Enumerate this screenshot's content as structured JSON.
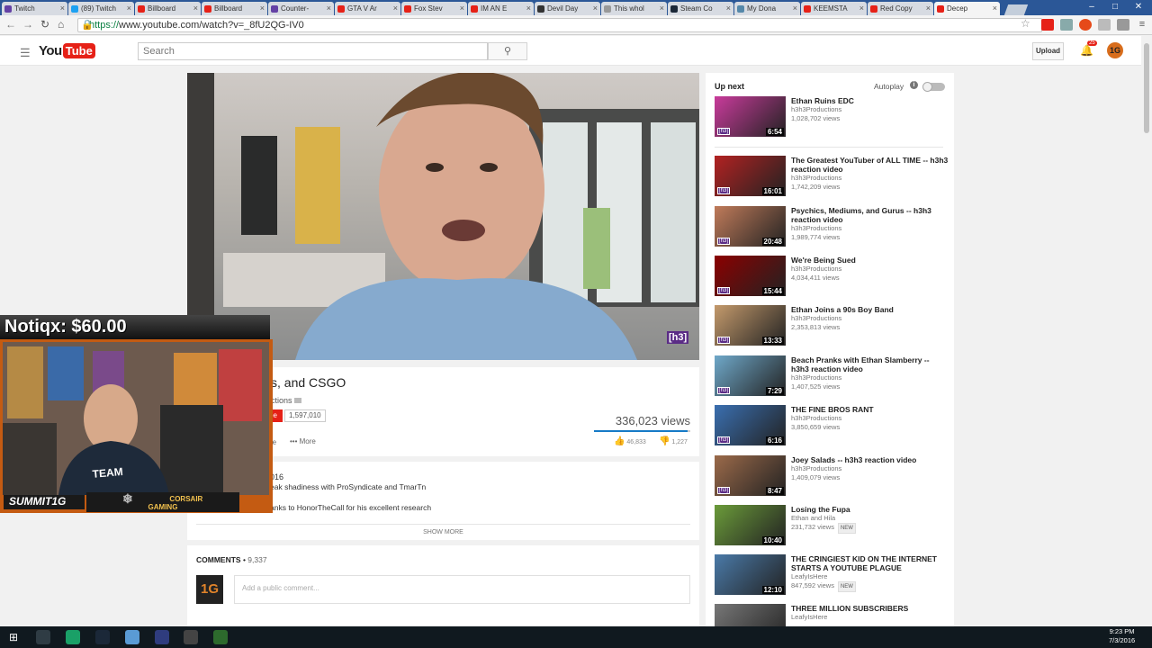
{
  "browser": {
    "tabs": [
      {
        "title": "Twitch",
        "color": "#6441a5",
        "active": false
      },
      {
        "title": "(89) Twitch",
        "color": "#1da1f2",
        "active": false
      },
      {
        "title": "Billboard",
        "color": "#e62117",
        "active": false
      },
      {
        "title": "Billboard",
        "color": "#e62117",
        "active": false
      },
      {
        "title": "Counter-",
        "color": "#6441a5",
        "active": false
      },
      {
        "title": "GTA V Ar",
        "color": "#e62117",
        "active": false
      },
      {
        "title": "Fox Stev",
        "color": "#e62117",
        "active": false
      },
      {
        "title": "IM AN E",
        "color": "#e62117",
        "active": false
      },
      {
        "title": "Devil Day",
        "color": "#333333",
        "active": false
      },
      {
        "title": "This whol",
        "color": "#999999",
        "active": false
      },
      {
        "title": "Steam Co",
        "color": "#1b2838",
        "active": false
      },
      {
        "title": "My Dona",
        "color": "#58a",
        "active": false
      },
      {
        "title": "KEEMSTA",
        "color": "#e62117",
        "active": false
      },
      {
        "title": "Red Copy",
        "color": "#e62117",
        "active": false
      },
      {
        "title": "Decep",
        "color": "#e62117",
        "active": true
      }
    ],
    "url_scheme": "https://",
    "url_rest": "www.youtube.com/watch?v=_8fU2QG-IV0"
  },
  "youtube": {
    "logo_you": "You",
    "logo_tube": "Tube",
    "search_placeholder": "Search",
    "upload_label": "Upload",
    "notification_count": "25",
    "avatar_text": "1G"
  },
  "video": {
    "watermark": "[h3]",
    "title_fragment": "s, and CSGO",
    "channel_fragment": "ctions",
    "subscribe_fragment": "be",
    "subscriber_count": "1,597,010",
    "view_count": "336,023 views",
    "share_fragment": "re",
    "more_label": "More",
    "likes": "46,833",
    "dislikes": "1,227",
    "like_ratio": 0.974
  },
  "description": {
    "date_fragment": "016",
    "line1_fragment": "eak shadiness with ProSyndicate and TmarTn",
    "line2_fragment": "anks to HonorTheCall for his excellent research",
    "show_more": "SHOW MORE"
  },
  "comments": {
    "label": "COMMENTS",
    "count": "9,337",
    "placeholder": "Add a public comment...",
    "avatar_text": "1G"
  },
  "sidebar": {
    "up_next": "Up next",
    "autoplay": "Autoplay",
    "videos": [
      {
        "title": "Ethan Ruins EDC",
        "channel": "h3h3Productions",
        "views": "1,028,702 views",
        "duration": "6:54",
        "new": false,
        "color": "#c93b9b"
      },
      {
        "title": "The Greatest YouTuber of ALL TIME -- h3h3 reaction video",
        "channel": "h3h3Productions",
        "views": "1,742,209 views",
        "duration": "16:01",
        "new": false,
        "color": "#b22222"
      },
      {
        "title": "Psychics, Mediums, and Gurus -- h3h3 reaction video",
        "channel": "h3h3Productions",
        "views": "1,989,774 views",
        "duration": "20:48",
        "new": false,
        "color": "#c07b5a"
      },
      {
        "title": "We're Being Sued",
        "channel": "h3h3Productions",
        "views": "4,034,411 views",
        "duration": "15:44",
        "new": false,
        "color": "#8b0000"
      },
      {
        "title": "Ethan Joins a 90s Boy Band",
        "channel": "h3h3Productions",
        "views": "2,353,813 views",
        "duration": "13:33",
        "new": false,
        "color": "#c49a6c"
      },
      {
        "title": "Beach Pranks with Ethan Slamberry -- h3h3 reaction video",
        "channel": "h3h3Productions",
        "views": "1,407,525 views",
        "duration": "7:29",
        "new": false,
        "color": "#6fa8c9"
      },
      {
        "title": "THE FINE BROS RANT",
        "channel": "h3h3Productions",
        "views": "3,850,659 views",
        "duration": "6:16",
        "new": false,
        "color": "#3a6fb0"
      },
      {
        "title": "Joey Salads -- h3h3 reaction video",
        "channel": "h3h3Productions",
        "views": "1,409,079 views",
        "duration": "8:47",
        "new": false,
        "color": "#9b6a4a"
      },
      {
        "title": "Losing the Fupa",
        "channel": "Ethan and Hila",
        "views": "231,732 views",
        "duration": "10:40",
        "new": true,
        "color": "#6b9b3a"
      },
      {
        "title": "THE CRINGIEST KID ON THE INTERNET STARTS A YOUTUBE PLAGUE",
        "channel": "LeafyIsHere",
        "views": "847,592 views",
        "duration": "12:10",
        "new": true,
        "color": "#4a7aa8"
      },
      {
        "title": "THREE MILLION SUBSCRIBERS",
        "channel": "LeafyIsHere",
        "views": "",
        "duration": "",
        "new": false,
        "color": "#777777"
      }
    ],
    "new_label": "NEW"
  },
  "overlay": {
    "donation": "Notiqx: $60.00",
    "streamer": "SUMMIT1G",
    "sponsor_line1": "CORSAIR",
    "sponsor_line2": "GAMING"
  },
  "taskbar": {
    "time": "9:23 PM",
    "date": "7/3/2016"
  }
}
